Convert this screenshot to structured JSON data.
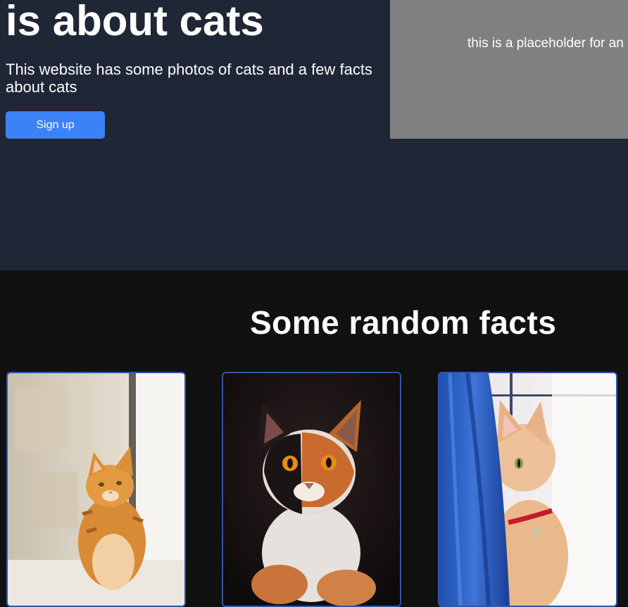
{
  "hero": {
    "title": "is about cats",
    "description": "This website has some photos of cats and a few facts about cats",
    "signup_label": "Sign up",
    "placeholder_text": "this is a placeholder for an"
  },
  "facts": {
    "title": "Some random facts",
    "cards": [
      {
        "image": "orange-tabby-cat-photo"
      },
      {
        "image": "calico-cat-photo"
      },
      {
        "image": "cream-cat-behind-blue-curtain-photo"
      }
    ]
  },
  "colors": {
    "hero_bg": "#1f2636",
    "page_bg": "#111111",
    "accent": "#3b82f6",
    "placeholder_bg": "#808080",
    "card_border": "#3156a6"
  }
}
